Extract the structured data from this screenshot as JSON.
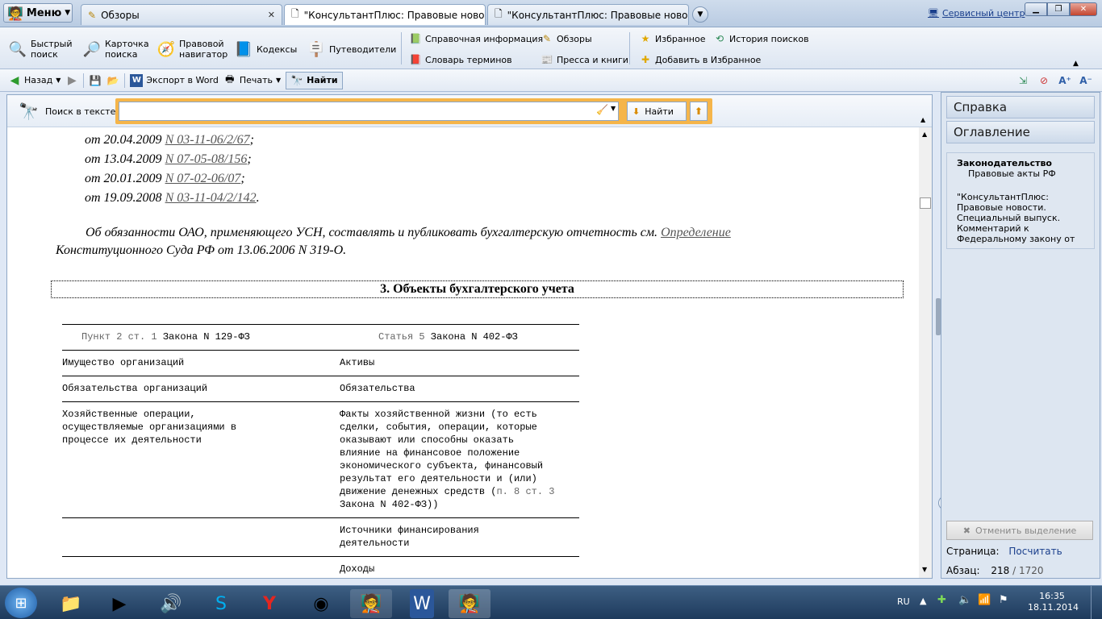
{
  "window": {
    "menu_label": "Меню",
    "tabs": [
      {
        "label": "Обзоры"
      },
      {
        "label": "\"КонсультантПлюс: Правовые новост..."
      },
      {
        "label": "\"КонсультантПлюс: Правовые новост..."
      }
    ],
    "service_center": "Сервисный центр"
  },
  "toolbar": {
    "quick_search": "Быстрый поиск",
    "search_card": "Карточка поиска",
    "legal_navigator": "Правовой навигатор",
    "codes": "Кодексы",
    "guides": "Путеводители",
    "reference_info": "Справочная информация",
    "glossary": "Словарь терминов",
    "reviews": "Обзоры",
    "press_books": "Пресса и книги",
    "favorites": "Избранное",
    "add_favorites": "Добавить в Избранное",
    "search_history": "История поисков"
  },
  "subtoolbar": {
    "back": "Назад",
    "export_word": "Экспорт в Word",
    "print": "Печать",
    "find": "Найти"
  },
  "search": {
    "label": "Поиск в тексте",
    "value": "",
    "find_button": "Найти"
  },
  "document": {
    "refs": [
      {
        "prefix": "от 20.04.2009 ",
        "link": "N 03-11-06/2/67",
        "suffix": ";"
      },
      {
        "prefix": "от 13.04.2009 ",
        "link": "N 07-05-08/156",
        "suffix": ";"
      },
      {
        "prefix": "от 20.01.2009 ",
        "link": "N 07-02-06/07",
        "suffix": ";"
      },
      {
        "prefix": "от 19.09.2008 ",
        "link": "N 03-11-04/2/142",
        "suffix": "."
      }
    ],
    "para_text": "Об обязанности ОАО, применяющего УСН, составлять и публиковать бухгалтерскую отчетность см. ",
    "para_link": "Определение",
    "para_text2": "Конституционного Суда РФ от 13.06.2006 N 319-О.",
    "section_title": "3. Объекты бухгалтерского учета",
    "table": {
      "head_left_a": "Пункт 2 ст. 1",
      "head_left_b": " Закона N 129-ФЗ",
      "head_right_a": "Статья 5",
      "head_right_b": " Закона N 402-ФЗ",
      "rows": [
        {
          "left": "Имущество организаций",
          "right": "Активы"
        },
        {
          "left": "Обязательства организаций",
          "right": "Обязательства"
        },
        {
          "left": "Хозяйственные операции,\nосуществляемые организациями в\nпроцессе их деятельности",
          "right": "Факты хозяйственной жизни (то есть\nсделки, события, операции, которые\nоказывают или способны оказать\nвлияние на финансовое положение\nэкономического субъекта, финансовый\nрезультат его деятельности и (или)\nдвижение денежных средств (",
          "right_link": "п. 8 ст. 3",
          "right_tail": "\nЗакона N 402-ФЗ))"
        },
        {
          "left": "",
          "right": "Источники финансирования\nдеятельности"
        },
        {
          "left": "",
          "right": "Доходы"
        }
      ]
    }
  },
  "right_panel": {
    "help": "Справка",
    "toc": "Оглавление",
    "info_title": "Законодательство",
    "info_subtitle": "Правовые акты РФ",
    "info_text": "\"КонсультантПлюс: Правовые новости. Специальный выпуск. Комментарий к Федеральному закону от",
    "cancel_selection": "Отменить выделение",
    "page_label": "Страница:",
    "page_link": "Посчитать",
    "para_label": "Абзац:",
    "para_current": "218",
    "para_total": "/ 1720"
  },
  "taskbar": {
    "lang": "RU",
    "time": "16:35",
    "date": "18.11.2014"
  },
  "colors": {
    "accent": "#f5b54a",
    "link": "#1a3f8c",
    "panel": "#dde6f1"
  }
}
